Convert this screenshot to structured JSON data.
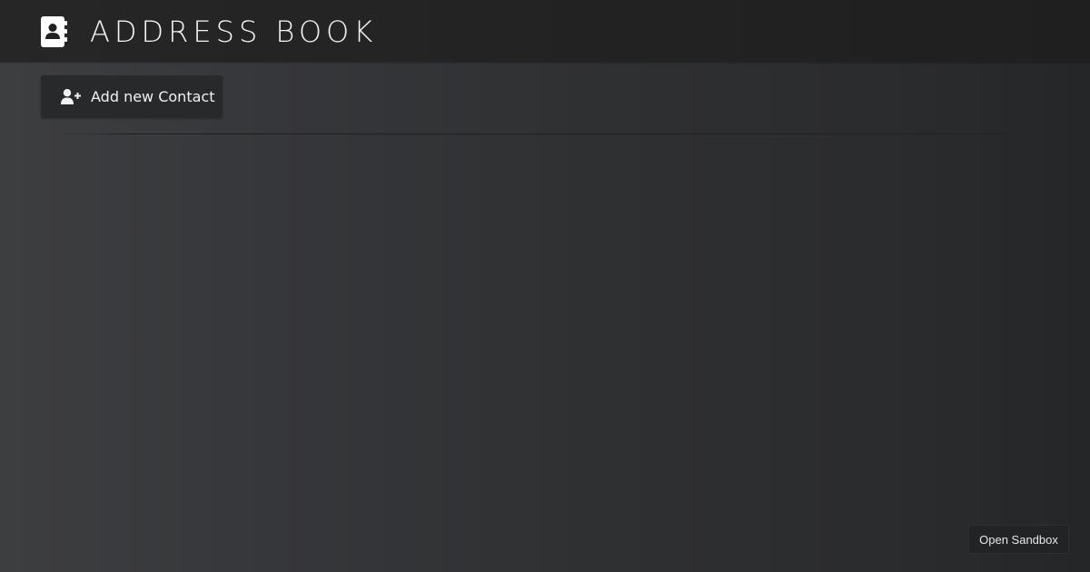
{
  "header": {
    "title": "ADDRESS BOOK",
    "logo_icon": "address-book-icon"
  },
  "toolbar": {
    "add_contact_label": "Add new Contact",
    "add_contact_icon": "user-plus-icon"
  },
  "footer": {
    "open_sandbox_label": "Open Sandbox"
  },
  "colors": {
    "header_bg": "#222222",
    "page_bg": "#333436",
    "button_bg": "#28292b",
    "text": "#ffffff"
  }
}
